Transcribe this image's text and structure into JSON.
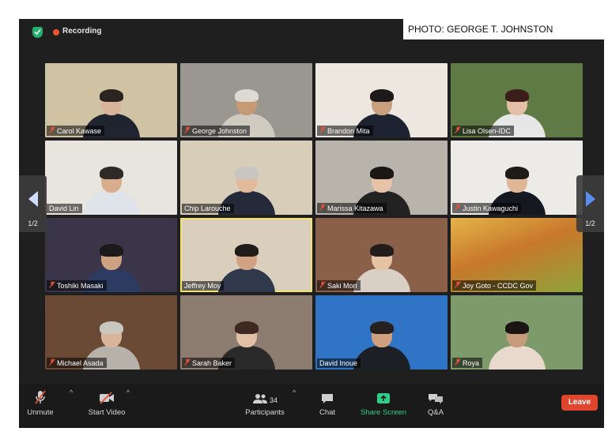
{
  "photo_credit": "PHOTO: GEORGE T. JOHNSTON",
  "meeting": {
    "recording_label": "Recording",
    "page_indicator_left": "1/2",
    "page_indicator_right": "1/2"
  },
  "participants": [
    {
      "name": "Carol Kawase",
      "muted": true,
      "bg": "#cfc3a4",
      "skin": "#d9b49a",
      "hair": "#2b2420",
      "shirt": "#1e2430"
    },
    {
      "name": "George Johnston",
      "muted": true,
      "bg": "#9a9690",
      "skin": "#c79a76",
      "hair": "#dcdad2",
      "shirt": "#cfcbc0"
    },
    {
      "name": "Brandon Mita",
      "muted": true,
      "bg": "#ece8e0",
      "skin": "#c9a07e",
      "hair": "#1c1a18",
      "shirt": "#1d2330"
    },
    {
      "name": "Lisa Olsen-IDC",
      "muted": true,
      "bg": "#5f7a45",
      "skin": "#e4bfa6",
      "hair": "#3b1d1a",
      "shirt": "#e7e7e7"
    },
    {
      "name": "David Lin",
      "muted": false,
      "bg": "#e8e4de",
      "skin": "#d7ad8e",
      "hair": "#2d2a28",
      "shirt": "#dfe3ea"
    },
    {
      "name": "Chip Larouche",
      "muted": false,
      "bg": "#d8cdb8",
      "skin": "#e2b99b",
      "hair": "#c8c6c2",
      "shirt": "#252a3a"
    },
    {
      "name": "Marissa Kitazawa",
      "muted": true,
      "bg": "#b9b4ab",
      "skin": "#e6c3a7",
      "hair": "#1a1716",
      "shirt": "#222222"
    },
    {
      "name": "Justin Kawaguchi",
      "muted": true,
      "bg": "#ecebe8",
      "skin": "#e0b796",
      "hair": "#1e1b19",
      "shirt": "#15181e"
    },
    {
      "name": "Toshiki Masaki",
      "muted": true,
      "bg": "#3a3548",
      "skin": "#cfa183",
      "hair": "#1b1919",
      "shirt": "#2b3b62"
    },
    {
      "name": "Jeffrey Moy",
      "muted": false,
      "bg": "#d9cfbc",
      "skin": "#d0a283",
      "hair": "#201c1a",
      "shirt": "#30394b",
      "active": true
    },
    {
      "name": "Saki Mori",
      "muted": true,
      "bg": "#8a6049",
      "skin": "#e5c2a4",
      "hair": "#221d1b",
      "shirt": "#d9cfc4"
    },
    {
      "name": "Joy Goto - CCDC Gov",
      "muted": true,
      "bg": "#c8782a",
      "skin": "#c8782a",
      "hair": "#c8782a",
      "shirt": "#7a9b3a",
      "no_person": true
    },
    {
      "name": "Michael Asada",
      "muted": true,
      "bg": "#6a4a35",
      "skin": "#dab39b",
      "hair": "#c9c6c0",
      "shirt": "#b6b1a9"
    },
    {
      "name": "Sarah Baker",
      "muted": true,
      "bg": "#8d7c70",
      "skin": "#e2c0a6",
      "hair": "#3b2922",
      "shirt": "#2a2a2a"
    },
    {
      "name": "David Inoue",
      "muted": false,
      "bg": "#2f74c5",
      "skin": "#cfa07d",
      "hair": "#26211e",
      "shirt": "#1c1f25"
    },
    {
      "name": "Roya",
      "muted": true,
      "bg": "#7d9a6a",
      "skin": "#c89b7c",
      "hair": "#1a1412",
      "shirt": "#e9d9cd"
    }
  ],
  "controls": {
    "unmute": "Unmute",
    "start_video": "Start Video",
    "participants": "Participants",
    "participant_count": "34",
    "chat": "Chat",
    "share_screen": "Share Screen",
    "qa": "Q&A",
    "leave": "Leave"
  },
  "colors": {
    "recording": "#f0562e",
    "secure": "#23b06d",
    "share_screen": "#2ad08a",
    "leave": "#e0452d",
    "muted_icon": "#e8503a"
  }
}
